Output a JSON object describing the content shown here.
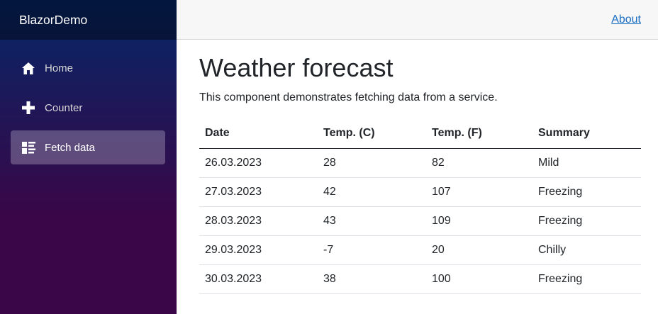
{
  "brand": "BlazorDemo",
  "nav": [
    {
      "label": "Home",
      "icon": "home-icon",
      "active": false
    },
    {
      "label": "Counter",
      "icon": "plus-icon",
      "active": false
    },
    {
      "label": "Fetch data",
      "icon": "list-rich-icon",
      "active": true
    }
  ],
  "topbar": {
    "about_label": "About"
  },
  "page": {
    "title": "Weather forecast",
    "description": "This component demonstrates fetching data from a service."
  },
  "table": {
    "headers": [
      "Date",
      "Temp. (C)",
      "Temp. (F)",
      "Summary"
    ],
    "rows": [
      [
        "26.03.2023",
        "28",
        "82",
        "Mild"
      ],
      [
        "27.03.2023",
        "42",
        "107",
        "Freezing"
      ],
      [
        "28.03.2023",
        "43",
        "109",
        "Freezing"
      ],
      [
        "29.03.2023",
        "-7",
        "20",
        "Chilly"
      ],
      [
        "30.03.2023",
        "38",
        "100",
        "Freezing"
      ]
    ]
  },
  "colors": {
    "link": "#1b6ec2",
    "sidebar_top": "#052767",
    "sidebar_bottom": "#3a0647"
  }
}
